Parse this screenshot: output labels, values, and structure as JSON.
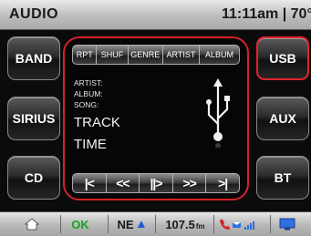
{
  "header": {
    "title": "AUDIO",
    "clock": "11:11am | 70°"
  },
  "left_buttons": [
    {
      "label": "BAND"
    },
    {
      "label": "SIRIUS"
    },
    {
      "label": "CD"
    }
  ],
  "right_buttons": [
    {
      "label": "USB",
      "active": true
    },
    {
      "label": "AUX"
    },
    {
      "label": "BT"
    }
  ],
  "modes": [
    "RPT",
    "SHUF",
    "GENRE",
    "ARTIST",
    "ALBUM"
  ],
  "track_info": {
    "artist_label": "ARTIST:",
    "album_label": "ALBUM:",
    "song_label": "SONG:",
    "track": "TRACK",
    "time": "TIME"
  },
  "transport": [
    "|<",
    "<<",
    "||>",
    ">>",
    ">|"
  ],
  "status": {
    "ok": "OK",
    "direction": "NE",
    "frequency": "107.5",
    "frequency_unit": "fm"
  },
  "colors": {
    "accent": "#d3222c",
    "ok": "#19a324",
    "nav_blue": "#1e5bd8"
  },
  "icons": {
    "home": "home-icon",
    "usb": "usb-icon",
    "phone": "phone-icon",
    "display": "display-icon"
  }
}
